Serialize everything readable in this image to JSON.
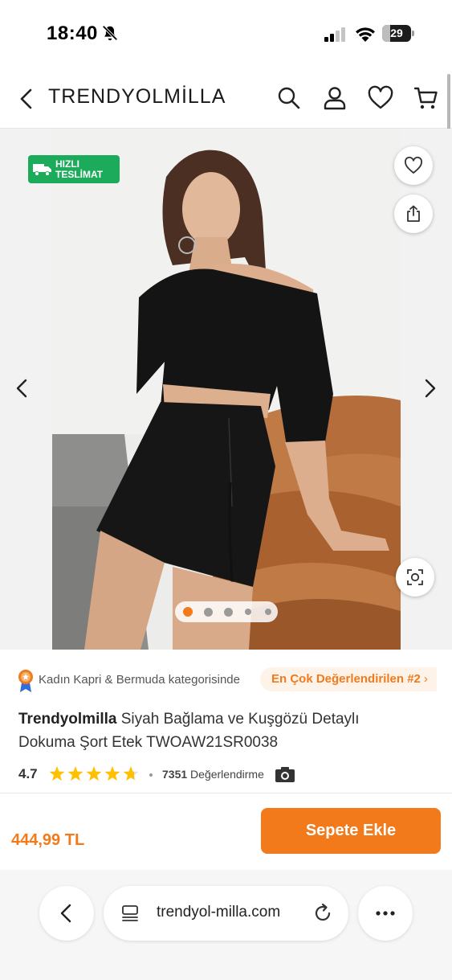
{
  "status_bar": {
    "time": "18:40",
    "battery": "29",
    "battery_fraction": 0.29
  },
  "header": {
    "brand": "TRENDYOLMİLLA"
  },
  "gallery": {
    "badge_line1": "HIZLI",
    "badge_line2": "TESLİMAT",
    "dot_count": 5,
    "active_dot": 0
  },
  "product": {
    "category_text": "Kadın Kapri & Bermuda kategorisinde",
    "rank_label": "En Çok Değerlendirilen #2",
    "rank_chevron": "›",
    "brand": "Trendyolmilla",
    "name": " Siyah Bağlama ve Kuşgözü Detaylı Dokuma Şort Etek TWOAW21SR0038",
    "rating": "4.7",
    "rating_value": 4.7,
    "rating_max": 5,
    "review_count": "7351",
    "review_label": " Değerlendirme",
    "price": "444,99 TL",
    "add_to_cart": "Sepete Ekle"
  },
  "browser": {
    "url": "trendyol-milla.com"
  },
  "colors": {
    "accent": "#f27a1a",
    "badge_green": "#1bab5a",
    "rank_bg": "#fef3e9"
  },
  "icons": [
    "bell-slash-icon",
    "signal-icon",
    "wifi-icon",
    "battery-icon",
    "back-icon",
    "search-icon",
    "user-icon",
    "heart-icon",
    "cart-icon",
    "truck-icon",
    "share-icon",
    "visual-search-icon",
    "chevron-left-icon",
    "chevron-right-icon",
    "medal-icon",
    "star-icon",
    "camera-icon",
    "tabs-icon",
    "reload-icon",
    "more-icon"
  ]
}
